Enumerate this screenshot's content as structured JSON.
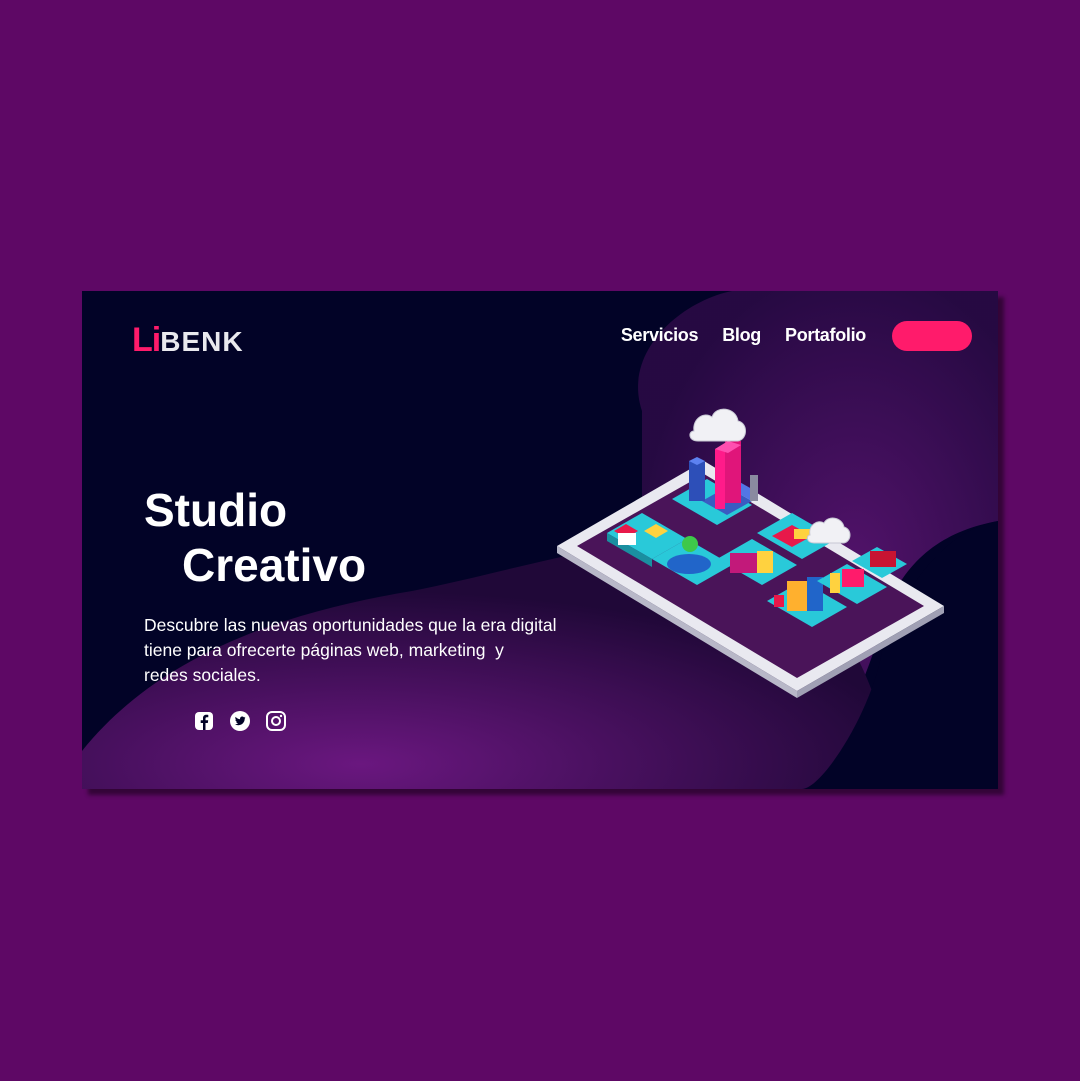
{
  "logo": {
    "part1": "Li",
    "part2": "BENK"
  },
  "nav": {
    "items": [
      "Servicios",
      "Blog",
      "Portafolio"
    ]
  },
  "cta": {
    "label": ""
  },
  "hero": {
    "title_line1": "Studio",
    "title_line2": "Creativo",
    "description_line1": "Descubre las nuevas oportunidades que la era digital",
    "description_line2": "tiene para ofrecerte páginas web, marketing  y",
    "description_line3": "redes sociales."
  },
  "social": {
    "icons": [
      "facebook-icon",
      "twitter-icon",
      "instagram-icon"
    ]
  },
  "colors": {
    "page_bg": "#5e0865",
    "card_bg": "#020327",
    "accent": "#ff1b6b",
    "blob": "#3c0c4f"
  }
}
